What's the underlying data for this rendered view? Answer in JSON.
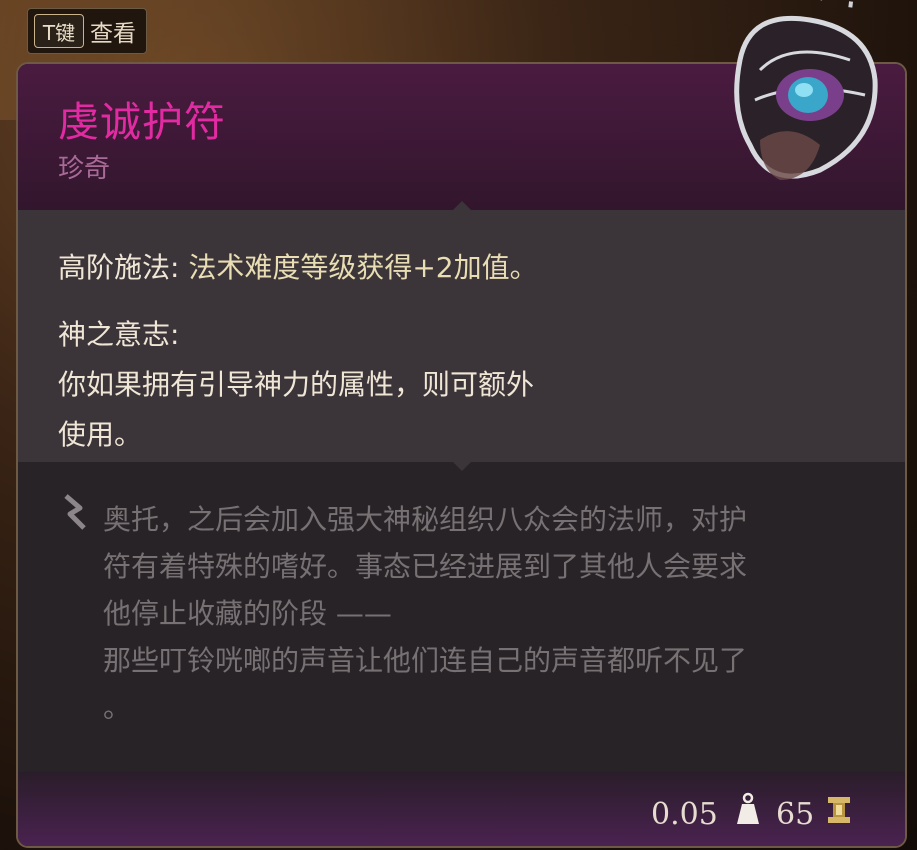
{
  "hint": {
    "key": "T键",
    "label": "查看"
  },
  "item": {
    "name": "虔诚护符",
    "rarity": "珍奇"
  },
  "properties": [
    {
      "name": "高阶施法: ",
      "value": "法术难度等级获得+2加值。"
    },
    {
      "name": "神之意志:",
      "lines": [
        "你如果拥有引导神力的属性，则可额外",
        "使用。"
      ]
    }
  ],
  "lore": [
    "奥托，之后会加入强大神秘组织八众会的法师，对护",
    "符有着特殊的嗜好。事态已经进展到了其他人会要求",
    "他停止收藏的阶段 ——",
    "那些叮铃咣啷的声音让他们连自己的声音都听不见了",
    "。"
  ],
  "footer": {
    "weight": "0.05",
    "price": "65"
  },
  "icons": {
    "weight": "weight-icon",
    "gold": "gold-icon",
    "lore": "quill-icon",
    "item": "amulet-icon"
  },
  "colors": {
    "rare_name": "#e22aa2",
    "rarity_label": "#a86b97",
    "lore_text": "#777174"
  }
}
